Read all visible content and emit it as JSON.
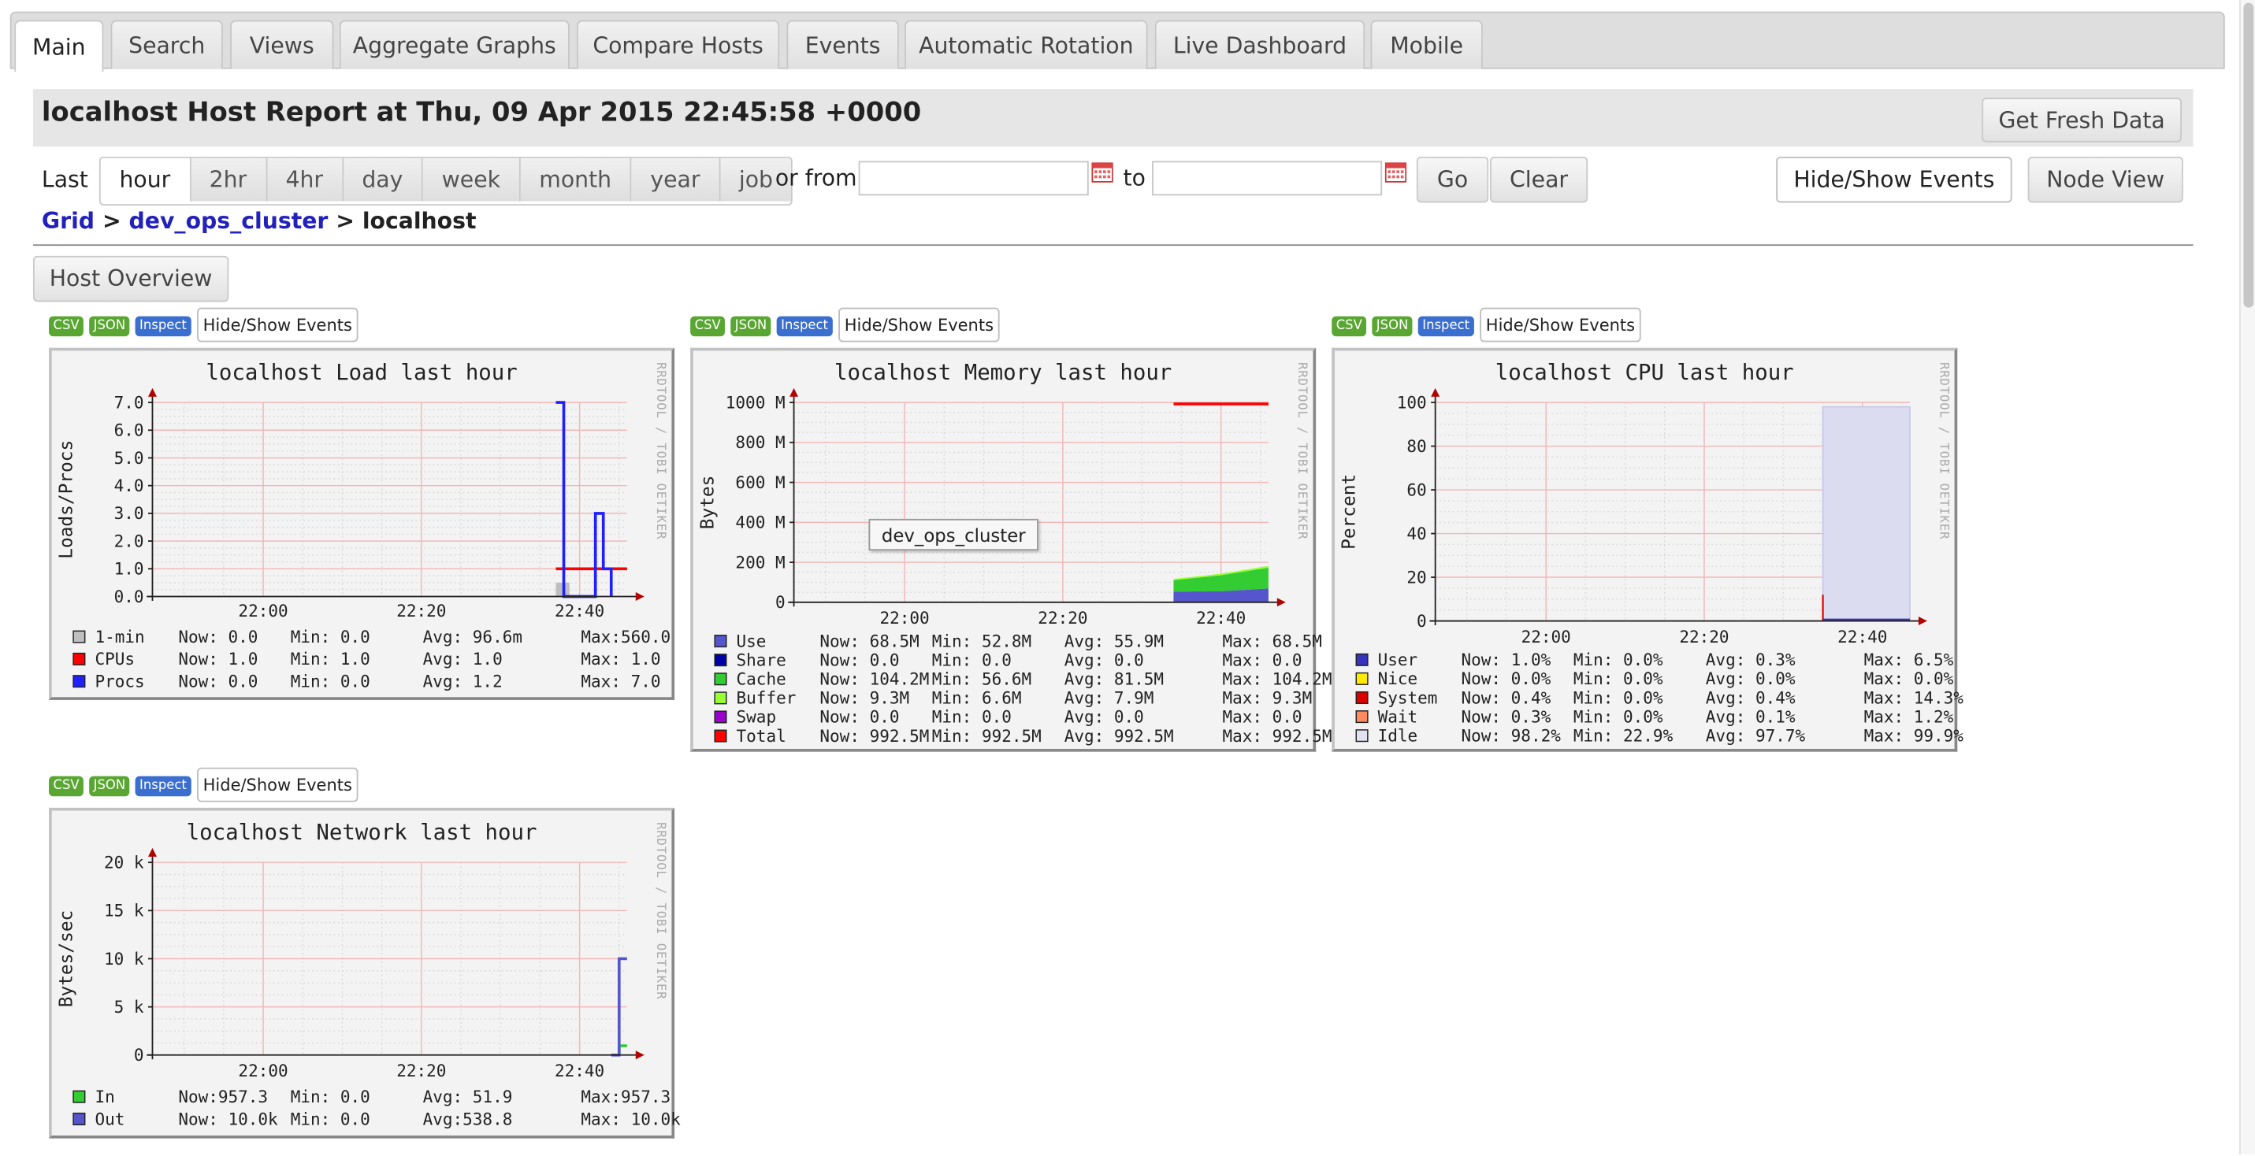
{
  "tabs": [
    "Main",
    "Search",
    "Views",
    "Aggregate Graphs",
    "Compare Hosts",
    "Events",
    "Automatic Rotation",
    "Live Dashboard",
    "Mobile"
  ],
  "active_tab": "Main",
  "header": {
    "title": "localhost Host Report at Thu, 09 Apr 2015 22:45:58 +0000",
    "fresh_button": "Get Fresh Data"
  },
  "controls": {
    "last_label": "Last",
    "ranges": [
      "hour",
      "2hr",
      "4hr",
      "day",
      "week",
      "month",
      "year",
      "job"
    ],
    "active_range": "hour",
    "or_from_label": "or from",
    "to_label": "to",
    "from_value": "",
    "to_value": "",
    "go_button": "Go",
    "clear_button": "Clear",
    "hide_show_events": "Hide/Show Events",
    "node_view": "Node View"
  },
  "breadcrumb": {
    "grid": "Grid",
    "cluster": "dev_ops_cluster",
    "sep": ">",
    "host": "localhost"
  },
  "host_overview_button": "Host Overview",
  "graph_buttons": {
    "csv": "CSV",
    "json": "JSON",
    "inspect": "Inspect",
    "events": "Hide/Show Events"
  },
  "watermark": "RRDTOOL / TOBI OETIKER",
  "tooltip": "dev_ops_cluster",
  "colors": {
    "grid_red": "#f3b6b6",
    "grid_dot": "#d9d9d9",
    "axis_red": "#b30000",
    "csv_green": "#5aa632",
    "inspect_blue": "#3a6fcf",
    "link_blue": "#2222bb"
  },
  "graphs": [
    {
      "title": "localhost Load last hour",
      "ylabel": "Loads/Procs",
      "legend": [
        {
          "name": "1-min",
          "color": "#bfbfbf",
          "now": "Now:  0.0",
          "min": "Min:  0.0",
          "avg": "Avg: 96.6m",
          "max": "Max:560.0"
        },
        {
          "name": "CPUs",
          "color": "#ff0000",
          "now": "Now:  1.0",
          "min": "Min:  1.0",
          "avg": "Avg:  1.0",
          "max": "Max:  1.0"
        },
        {
          "name": "Procs",
          "color": "#2020ff",
          "now": "Now:  0.0",
          "min": "Min:  0.0",
          "avg": "Avg:  1.2",
          "max": "Max:  7.0"
        }
      ],
      "chart_data": {
        "type": "line",
        "title": "localhost Load last hour",
        "xlabel": "",
        "ylabel": "Loads/Procs",
        "x_ticks": [
          "22:00",
          "22:20",
          "22:40"
        ],
        "y_ticks": [
          "0.0",
          "1.0",
          "2.0",
          "3.0",
          "4.0",
          "5.0",
          "6.0",
          "7.0"
        ],
        "ylim": [
          0,
          7
        ],
        "x_range": [
          "21:46",
          "22:46"
        ],
        "series": [
          {
            "name": "1-min",
            "points": [
              [
                "22:37",
                0
              ],
              [
                "22:37",
                0.5
              ],
              [
                "22:38",
                0.5
              ],
              [
                "22:38",
                0
              ]
            ]
          },
          {
            "name": "CPUs",
            "points": [
              [
                "22:37",
                1
              ],
              [
                "22:46",
                1
              ]
            ]
          },
          {
            "name": "Procs",
            "points": [
              [
                "22:37",
                7
              ],
              [
                "22:38",
                7
              ],
              [
                "22:38",
                0
              ],
              [
                "22:39",
                0
              ],
              [
                "22:39",
                0
              ],
              [
                "22:42",
                0
              ],
              [
                "22:42",
                3
              ],
              [
                "22:43",
                3
              ],
              [
                "22:43",
                1
              ],
              [
                "22:44",
                1
              ],
              [
                "22:44",
                0
              ]
            ]
          }
        ]
      }
    },
    {
      "title": "localhost Memory last hour",
      "ylabel": "Bytes",
      "legend": [
        {
          "name": "Use",
          "color": "#5555cc",
          "now": "Now:  68.5M",
          "min": "Min:  52.8M",
          "avg": "Avg:  55.9M",
          "max": "Max:  68.5M"
        },
        {
          "name": "Share",
          "color": "#0000aa",
          "now": "Now:   0.0",
          "min": "Min:   0.0",
          "avg": "Avg:   0.0",
          "max": "Max:   0.0"
        },
        {
          "name": "Cache",
          "color": "#33cc33",
          "now": "Now: 104.2M",
          "min": "Min:  56.6M",
          "avg": "Avg:  81.5M",
          "max": "Max: 104.2M"
        },
        {
          "name": "Buffer",
          "color": "#99ff33",
          "now": "Now:   9.3M",
          "min": "Min:   6.6M",
          "avg": "Avg:   7.9M",
          "max": "Max:   9.3M"
        },
        {
          "name": "Swap",
          "color": "#9900cc",
          "now": "Now:   0.0",
          "min": "Min:   0.0",
          "avg": "Avg:   0.0",
          "max": "Max:   0.0"
        },
        {
          "name": "Total",
          "color": "#ff0000",
          "now": "Now: 992.5M",
          "min": "Min: 992.5M",
          "avg": "Avg: 992.5M",
          "max": "Max: 992.5M"
        }
      ],
      "chart_data": {
        "type": "area",
        "title": "localhost Memory last hour",
        "xlabel": "",
        "ylabel": "Bytes",
        "x_ticks": [
          "22:00",
          "22:20",
          "22:40"
        ],
        "y_ticks": [
          "0",
          "200 M",
          "400 M",
          "600 M",
          "800 M",
          "1000 M"
        ],
        "ylim": [
          0,
          1000
        ],
        "x_range": [
          "21:46",
          "22:46"
        ],
        "series": [
          {
            "name": "Use",
            "points": [
              [
                "22:34",
                53
              ],
              [
                "22:40",
                55
              ],
              [
                "22:46",
                68.5
              ]
            ]
          },
          {
            "name": "Cache",
            "points": [
              [
                "22:34",
                57
              ],
              [
                "22:40",
                80
              ],
              [
                "22:46",
                104.2
              ]
            ]
          },
          {
            "name": "Buffer",
            "points": [
              [
                "22:34",
                7
              ],
              [
                "22:40",
                8
              ],
              [
                "22:46",
                9.3
              ]
            ]
          },
          {
            "name": "Total",
            "points": [
              [
                "22:34",
                992.5
              ],
              [
                "22:46",
                992.5
              ]
            ]
          }
        ]
      }
    },
    {
      "title": "localhost CPU last hour",
      "ylabel": "Percent",
      "legend": [
        {
          "name": "User",
          "color": "#3333bb",
          "now": "Now:  1.0%",
          "min": "Min:  0.0%",
          "avg": "Avg:  0.3%",
          "max": "Max:  6.5%"
        },
        {
          "name": "Nice",
          "color": "#ffea00",
          "now": "Now:  0.0%",
          "min": "Min:  0.0%",
          "avg": "Avg:  0.0%",
          "max": "Max:  0.0%"
        },
        {
          "name": "System",
          "color": "#dd0000",
          "now": "Now:  0.4%",
          "min": "Min:  0.0%",
          "avg": "Avg:  0.4%",
          "max": "Max: 14.3%"
        },
        {
          "name": "Wait",
          "color": "#ff8a60",
          "now": "Now:  0.3%",
          "min": "Min:  0.0%",
          "avg": "Avg:  0.1%",
          "max": "Max:  1.2%"
        },
        {
          "name": "Idle",
          "color": "#e2e2f2",
          "now": "Now: 98.2%",
          "min": "Min: 22.9%",
          "avg": "Avg: 97.7%",
          "max": "Max: 99.9%"
        }
      ],
      "chart_data": {
        "type": "area",
        "title": "localhost CPU last hour",
        "xlabel": "",
        "ylabel": "Percent",
        "x_ticks": [
          "22:00",
          "22:20",
          "22:40"
        ],
        "y_ticks": [
          "0",
          "20",
          "40",
          "60",
          "80",
          "100"
        ],
        "ylim": [
          0,
          100
        ],
        "x_range": [
          "21:46",
          "22:46"
        ],
        "series": [
          {
            "name": "Idle",
            "points": [
              [
                "22:35",
                98
              ],
              [
                "22:46",
                98
              ]
            ]
          },
          {
            "name": "User",
            "points": [
              [
                "22:35",
                1
              ],
              [
                "22:46",
                1
              ]
            ]
          },
          {
            "name": "System",
            "points": [
              [
                "22:35",
                0.4
              ],
              [
                "22:46",
                0.4
              ]
            ]
          }
        ]
      }
    },
    {
      "title": "localhost Network last hour",
      "ylabel": "Bytes/sec",
      "legend": [
        {
          "name": "In",
          "color": "#33cc33",
          "now": "Now:957.3",
          "min": "Min:   0.0",
          "avg": "Avg:  51.9",
          "max": "Max:957.3"
        },
        {
          "name": "Out",
          "color": "#5555cc",
          "now": "Now: 10.0k",
          "min": "Min:   0.0",
          "avg": "Avg:538.8",
          "max": "Max: 10.0k"
        }
      ],
      "chart_data": {
        "type": "line",
        "title": "localhost Network last hour",
        "xlabel": "",
        "ylabel": "Bytes/sec",
        "x_ticks": [
          "22:00",
          "22:20",
          "22:40"
        ],
        "y_ticks": [
          "0",
          "5 k",
          "10 k",
          "15 k",
          "20 k"
        ],
        "ylim": [
          0,
          20
        ],
        "x_range": [
          "21:46",
          "22:46"
        ],
        "series": [
          {
            "name": "In",
            "points": [
              [
                "22:45",
                0
              ],
              [
                "22:45",
                0.957
              ],
              [
                "22:46",
                0.957
              ]
            ]
          },
          {
            "name": "Out",
            "points": [
              [
                "22:44",
                0
              ],
              [
                "22:45",
                0
              ],
              [
                "22:45",
                10
              ],
              [
                "22:46",
                10
              ]
            ]
          }
        ]
      }
    }
  ]
}
